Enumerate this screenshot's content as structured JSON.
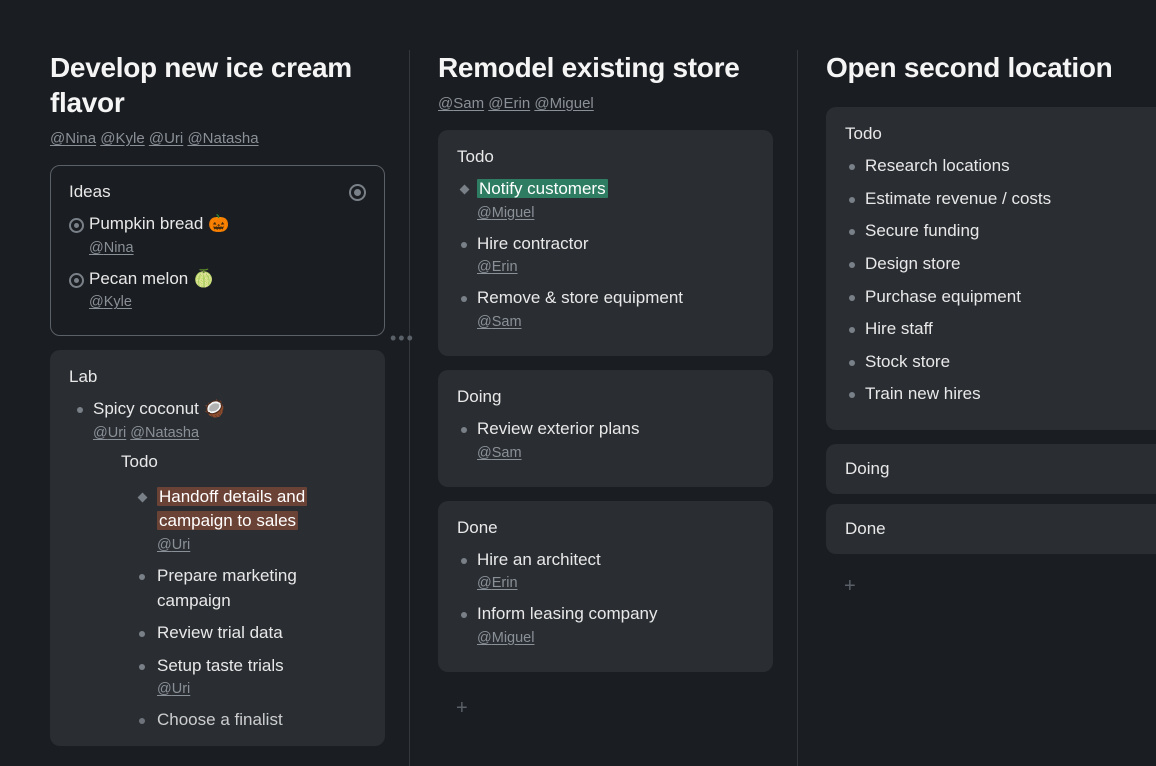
{
  "columns": [
    {
      "title": "Develop new ice cream flavor",
      "assignees": [
        "Nina",
        "Kyle",
        "Uri",
        "Natasha"
      ],
      "sections": [
        {
          "kind": "ideas",
          "title": "Ideas",
          "selected": true,
          "show_target": true,
          "items": [
            {
              "text": "Pumpkin bread 🎃",
              "assignees": [
                "Nina"
              ],
              "bullet": "ring"
            },
            {
              "text": "Pecan melon 🍈",
              "assignees": [
                "Kyle"
              ],
              "bullet": "ring"
            }
          ]
        },
        {
          "kind": "lab",
          "title": "Lab",
          "items": [
            {
              "text": "Spicy coconut 🥥",
              "assignees": [
                "Uri",
                "Natasha"
              ],
              "bullet": "dot",
              "sub": {
                "title": "Todo",
                "items": [
                  {
                    "text": "Handoff details and campaign to sales",
                    "assignees": [
                      "Uri"
                    ],
                    "bullet": "diamond",
                    "highlight": "brown"
                  },
                  {
                    "text": "Prepare marketing campaign",
                    "bullet": "dot"
                  },
                  {
                    "text": "Review trial data",
                    "bullet": "dot"
                  },
                  {
                    "text": "Setup taste trials",
                    "assignees": [
                      "Uri"
                    ],
                    "bullet": "dot"
                  },
                  {
                    "text": "Choose a finalist",
                    "bullet": "dot"
                  }
                ]
              }
            }
          ]
        }
      ]
    },
    {
      "title": "Remodel existing store",
      "assignees": [
        "Sam",
        "Erin",
        "Miguel"
      ],
      "sections": [
        {
          "kind": "todo",
          "title": "Todo",
          "items": [
            {
              "text": "Notify customers",
              "assignees": [
                "Miguel"
              ],
              "bullet": "diamond",
              "highlight": "green"
            },
            {
              "text": "Hire contractor",
              "assignees": [
                "Erin"
              ],
              "bullet": "dot"
            },
            {
              "text": "Remove & store equipment",
              "assignees": [
                "Sam"
              ],
              "bullet": "dot"
            }
          ]
        },
        {
          "kind": "doing",
          "title": "Doing",
          "items": [
            {
              "text": "Review exterior plans",
              "assignees": [
                "Sam"
              ],
              "bullet": "dot"
            }
          ]
        },
        {
          "kind": "done",
          "title": "Done",
          "items": [
            {
              "text": "Hire an architect",
              "assignees": [
                "Erin"
              ],
              "bullet": "dot"
            },
            {
              "text": "Inform leasing company",
              "assignees": [
                "Miguel"
              ],
              "bullet": "dot"
            }
          ]
        }
      ],
      "show_add": true
    },
    {
      "title": "Open second location",
      "assignees": [],
      "sections": [
        {
          "kind": "todo",
          "title": "Todo",
          "items": [
            {
              "text": "Research locations",
              "bullet": "dot"
            },
            {
              "text": "Estimate revenue / costs",
              "bullet": "dot"
            },
            {
              "text": "Secure funding",
              "bullet": "dot"
            },
            {
              "text": "Design store",
              "bullet": "dot"
            },
            {
              "text": "Purchase equipment",
              "bullet": "dot"
            },
            {
              "text": "Hire staff",
              "bullet": "dot"
            },
            {
              "text": "Stock store",
              "bullet": "dot"
            },
            {
              "text": "Train new hires",
              "bullet": "dot"
            }
          ]
        },
        {
          "kind": "doing",
          "title": "Doing",
          "compact": true,
          "items": []
        },
        {
          "kind": "done",
          "title": "Done",
          "compact": true,
          "items": []
        }
      ],
      "show_add": true
    }
  ],
  "add_label": "+"
}
